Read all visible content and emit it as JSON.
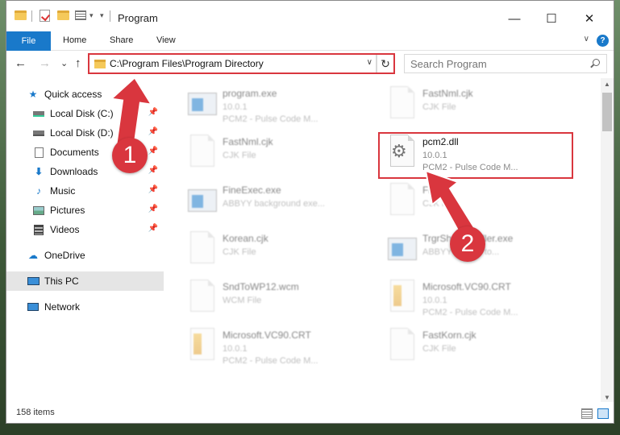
{
  "window": {
    "title": "Program",
    "controls": {
      "minimize": "—",
      "maximize": "☐",
      "close": "✕"
    }
  },
  "ribbon": {
    "file_tab": "File",
    "tabs": [
      "Home",
      "Share",
      "View"
    ],
    "help": "?"
  },
  "navigation": {
    "back": "←",
    "forward": "→",
    "recent": "⌄",
    "up": "↑",
    "address_path": "C:\\Program Files\\Program Directory",
    "refresh": "↻",
    "search_placeholder": "Search Program"
  },
  "sidebar": {
    "items": [
      {
        "label": "Quick access",
        "icon": "star-icon",
        "pinned": false
      },
      {
        "label": "Local Disk (C:)",
        "icon": "drive-icon",
        "pinned": true
      },
      {
        "label": "Local Disk (D:)",
        "icon": "drive-icon",
        "pinned": true
      },
      {
        "label": "Documents",
        "icon": "documents-icon",
        "pinned": true
      },
      {
        "label": "Downloads",
        "icon": "download-icon",
        "pinned": true
      },
      {
        "label": "Music",
        "icon": "music-icon",
        "pinned": true
      },
      {
        "label": "Pictures",
        "icon": "pictures-icon",
        "pinned": true
      },
      {
        "label": "Videos",
        "icon": "videos-icon",
        "pinned": true
      },
      {
        "label": "OneDrive",
        "icon": "cloud-icon",
        "pinned": false
      },
      {
        "label": "This PC",
        "icon": "pc-icon",
        "pinned": false,
        "selected": true
      },
      {
        "label": "Network",
        "icon": "network-icon",
        "pinned": false
      }
    ]
  },
  "files": [
    {
      "name": "program.exe",
      "line2": "10.0.1",
      "line3": "PCM2 - Pulse Code M...",
      "type": "exe",
      "blurred": true
    },
    {
      "name": "FastNml.cjk",
      "line2": "CJK File",
      "line3": "",
      "type": "doc",
      "blurred": true
    },
    {
      "name": "FastNml.cjk",
      "line2": "CJK File",
      "line3": "",
      "type": "doc",
      "blurred": true
    },
    {
      "name": "pcm2.dll",
      "line2": "10.0.1",
      "line3": "PCM2 - Pulse Code M...",
      "type": "dll",
      "blurred": false
    },
    {
      "name": "FineExec.exe",
      "line2": "ABBYY background exe...",
      "line3": "",
      "type": "exe",
      "blurred": true
    },
    {
      "name": "Fi..cjk",
      "line2": "CJK File",
      "line3": "",
      "type": "doc",
      "blurred": true
    },
    {
      "name": "Korean.cjk",
      "line2": "CJK File",
      "line3": "",
      "type": "doc",
      "blurred": true
    },
    {
      "name": "TrgrShellInstaller.exe",
      "line2": "ABBYY Loader to...",
      "line3": "",
      "type": "exe",
      "blurred": true
    },
    {
      "name": "SndToWP12.wcm",
      "line2": "WCM File",
      "line3": "",
      "type": "doc",
      "blurred": true
    },
    {
      "name": "Microsoft.VC90.CRT",
      "line2": "10.0.1",
      "line3": "PCM2 - Pulse Code M...",
      "type": "zip",
      "blurred": true
    },
    {
      "name": "Microsoft.VC90.CRT",
      "line2": "10.0.1",
      "line3": "PCM2 - Pulse Code M...",
      "type": "zip",
      "blurred": true
    },
    {
      "name": "FastKorn.cjk",
      "line2": "CJK File",
      "line3": "",
      "type": "doc",
      "blurred": true
    }
  ],
  "status": {
    "item_count": "158 items"
  },
  "annotations": {
    "step1": "1",
    "step2": "2",
    "highlight_color": "#d9363e"
  },
  "colors": {
    "accent": "#1979ca",
    "highlight": "#d9363e",
    "folder": "#f5c95a"
  }
}
